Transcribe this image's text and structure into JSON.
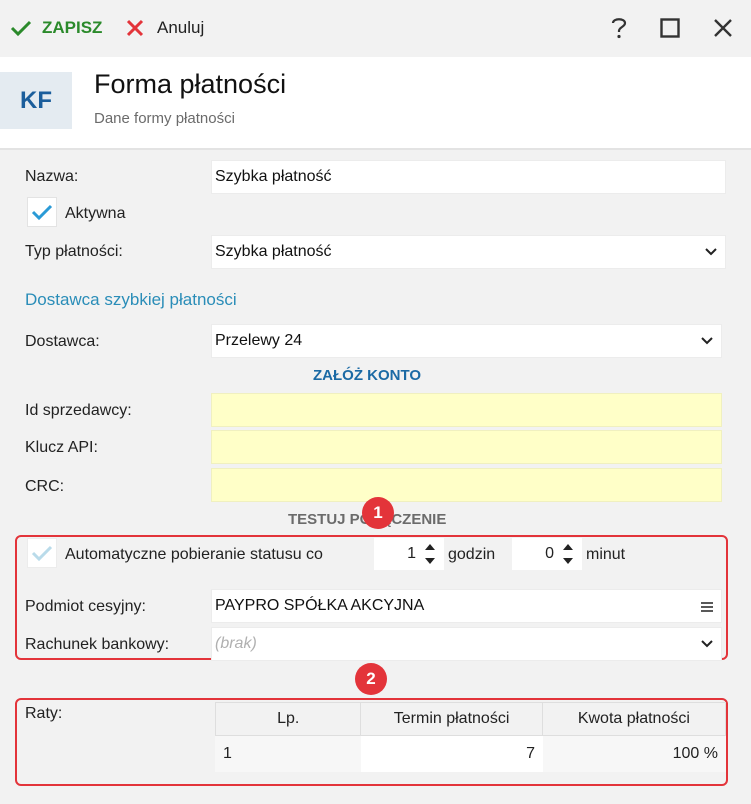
{
  "toolbar": {
    "save_label": "ZAPISZ",
    "cancel_label": "Anuluj"
  },
  "header": {
    "logo": "KF",
    "title": "Forma płatności",
    "subtitle": "Dane formy płatności"
  },
  "form": {
    "name_label": "Nazwa:",
    "name_value": "Szybka płatność",
    "active_label": "Aktywna",
    "active_checked": true,
    "type_label": "Typ płatności:",
    "type_value": "Szybka płatność",
    "provider_section": "Dostawca szybkiej płatności",
    "provider_label": "Dostawca:",
    "provider_value": "Przelewy 24",
    "create_account": "ZAŁÓŻ KONTO",
    "seller_id_label": "Id sprzedawcy:",
    "seller_id_value": "",
    "api_key_label": "Klucz API:",
    "api_key_value": "",
    "crc_label": "CRC:",
    "crc_value": "",
    "test_connection": "TESTUJ POŁĄCZENIE",
    "auto_status_label": "Automatyczne pobieranie statusu co",
    "auto_status_checked": true,
    "hours_value": "1",
    "hours_label": "godzin",
    "minutes_value": "0",
    "minutes_label": "minut",
    "cessionary_label": "Podmiot cesyjny:",
    "cessionary_value": "PAYPRO SPÓŁKA AKCYJNA",
    "bank_account_label": "Rachunek bankowy:",
    "bank_account_placeholder": "(brak)"
  },
  "badges": [
    "1",
    "2"
  ],
  "installments": {
    "label": "Raty:",
    "columns": [
      "Lp.",
      "Termin płatności",
      "Kwota płatności"
    ],
    "rows": [
      {
        "lp": "1",
        "term": "7",
        "amount": "100 %"
      }
    ]
  },
  "colors": {
    "accent_red": "#e3343a",
    "save_green": "#2b8a2b",
    "link_blue": "#2a8db8",
    "required_yellow": "#ffffc8"
  }
}
